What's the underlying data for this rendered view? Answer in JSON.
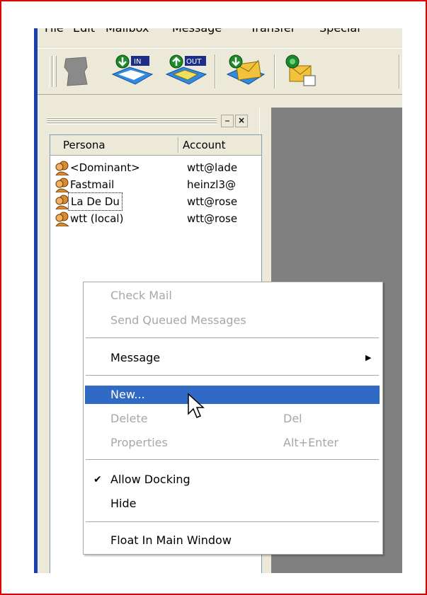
{
  "menubar": {
    "items": [
      "File",
      "Edit",
      "Mailbox",
      "Message",
      "Transfer",
      "Special"
    ]
  },
  "toolbar": {
    "buttons": [
      {
        "icon": "personality-icon"
      },
      {
        "icon": "check-mail-inbox-icon",
        "badge": "IN"
      },
      {
        "icon": "send-outbox-icon",
        "badge": "OUT"
      },
      {
        "icon": "new-message-icon"
      },
      {
        "icon": "reply-icon"
      }
    ]
  },
  "panel": {
    "columns": [
      "Persona",
      "Account"
    ],
    "rows": [
      {
        "persona": "<Dominant>",
        "account": "wtt@lade"
      },
      {
        "persona": "Fastmail",
        "account": "heinzl3@"
      },
      {
        "persona": "La De Du",
        "account": "wtt@rose"
      },
      {
        "persona": "wtt (local)",
        "account": "wtt@rose"
      }
    ],
    "close_glyph": "×",
    "restore_glyph": "⎯"
  },
  "context_menu": {
    "check_mail": "Check Mail",
    "send_queued": "Send Queued Messages",
    "message": "Message",
    "submenu_arrow": "▶",
    "new": "New...",
    "delete": "Delete",
    "delete_shortcut": "Del",
    "properties": "Properties",
    "properties_shortcut": "Alt+Enter",
    "allow_docking": "Allow Docking",
    "checkmark": "✔",
    "hide": "Hide",
    "float": "Float In Main Window"
  },
  "colors": {
    "highlight": "#316ac5",
    "frame_border": "#e00000",
    "disabled": "#a7a6aa"
  }
}
